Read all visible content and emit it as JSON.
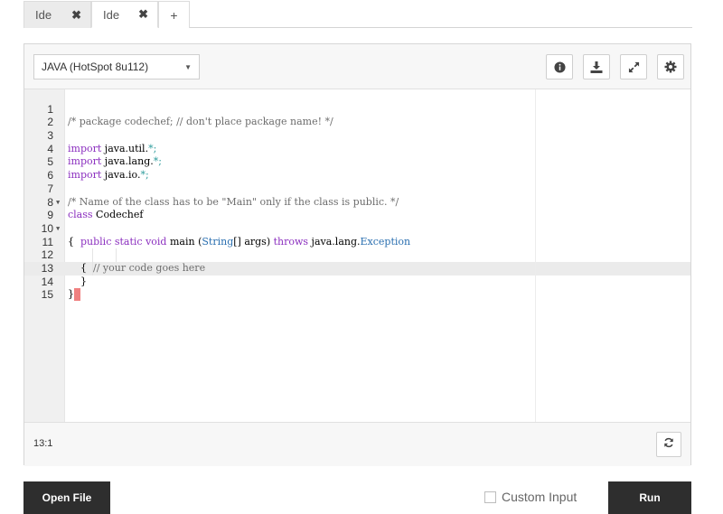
{
  "tabs": [
    {
      "label": "Ide",
      "close": "✖",
      "active": false
    },
    {
      "label": "Ide",
      "close": "✖",
      "active": true
    }
  ],
  "add_tab": "+",
  "toolbar": {
    "language": "JAVA (HotSpot 8u112)",
    "icons": [
      "info-icon",
      "download-icon",
      "expand-icon",
      "settings-icon"
    ]
  },
  "editor": {
    "line_numbers": [
      "1",
      "2",
      "3",
      "4",
      "5",
      "6",
      "7",
      "8",
      "9",
      "10",
      "11",
      "12",
      "13",
      "14",
      "15"
    ],
    "lines": {
      "l1": "/* package codechef; // don't place package name! */",
      "l3_kw": "import",
      "l3_rest": " java.util.",
      "l3_star": "*;",
      "l4_kw": "import",
      "l4_rest": " java.lang.",
      "l4_star": "*;",
      "l5_kw": "import",
      "l5_rest": " java.io.",
      "l5_star": "*;",
      "l7": "/* Name of the class has to be \"Main\" only if the class is public. */",
      "l8_kw": "class",
      "l8_rest": " Codechef",
      "l9": "{",
      "l10_a": "public static void",
      "l10_b": " main (",
      "l10_c": "String",
      "l10_d": "[] args) ",
      "l10_e": "throws",
      "l10_f": " java.lang.",
      "l10_g": "Exception",
      "l11": "{",
      "l12": "// your code goes here",
      "l13": "}",
      "l14": "}"
    }
  },
  "status": {
    "cursor_position": "13:1"
  },
  "bottom": {
    "open_file": "Open File",
    "custom_input": "Custom Input",
    "run": "Run"
  }
}
